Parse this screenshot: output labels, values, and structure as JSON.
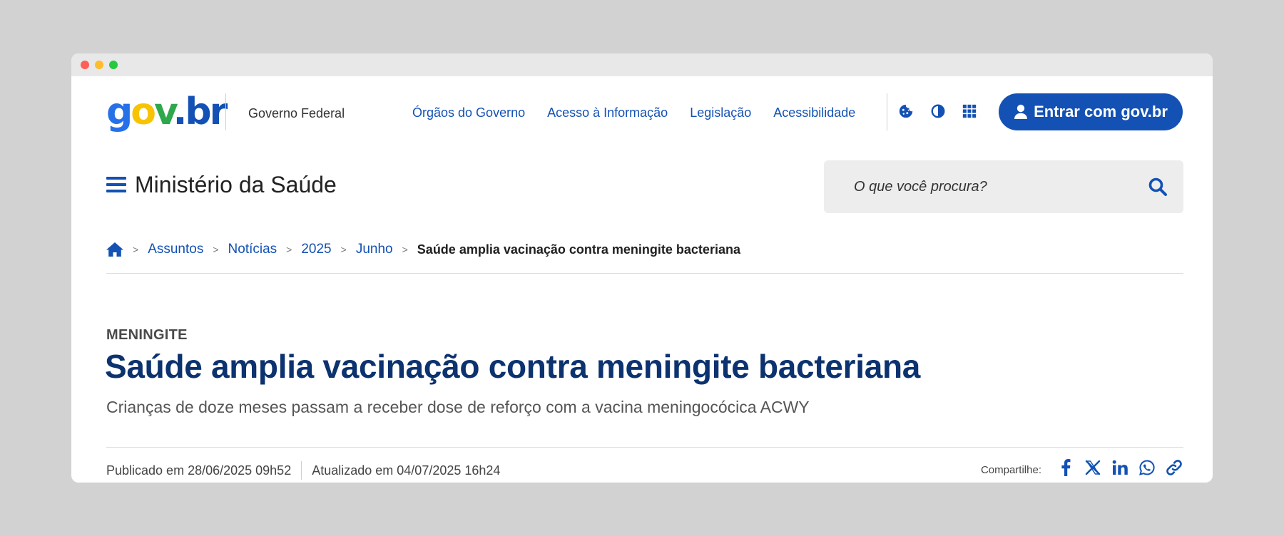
{
  "header": {
    "logo_parts": [
      "g",
      "o",
      "v",
      ".br"
    ],
    "org_name": "Governo Federal",
    "nav_links": [
      "Órgãos do Governo",
      "Acesso à Informação",
      "Legislação",
      "Acessibilidade"
    ],
    "tool_icons": [
      "cookie-icon",
      "contrast-icon",
      "apps-grid-icon"
    ],
    "login_label": "Entrar com gov.br"
  },
  "site": {
    "title": "Ministério da Saúde"
  },
  "search": {
    "placeholder": "O que você procura?"
  },
  "breadcrumb": {
    "items": [
      "Assuntos",
      "Notícias",
      "2025",
      "Junho"
    ],
    "current": "Saúde amplia vacinação contra meningite bacteriana"
  },
  "article": {
    "kicker": "MENINGITE",
    "title": "Saúde amplia vacinação contra meningite bacteriana",
    "subtitle": "Crianças de doze meses passam a receber dose de reforço com a vacina meningocócica ACWY",
    "published": "Publicado em 28/06/2025 09h52",
    "updated": "Atualizado em 04/07/2025 16h24"
  },
  "share": {
    "label": "Compartilhe:",
    "icons": [
      "facebook-icon",
      "x-icon",
      "linkedin-icon",
      "whatsapp-icon",
      "link-icon"
    ]
  },
  "colors": {
    "primary": "#1351b4",
    "headline": "#0c326f",
    "search_bg": "#ededed"
  }
}
